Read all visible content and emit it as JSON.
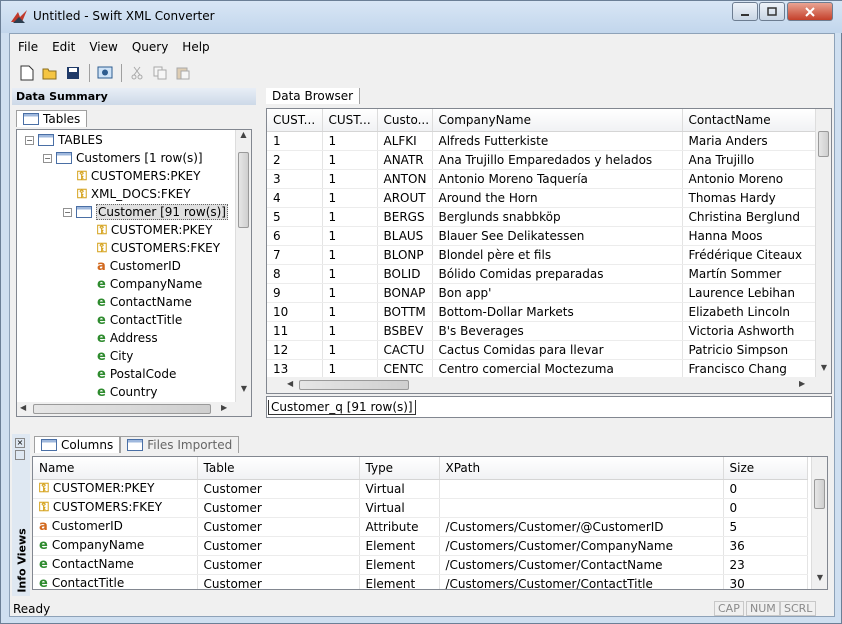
{
  "window": {
    "title": "Untitled - Swift XML Converter"
  },
  "menu": [
    "File",
    "Edit",
    "View",
    "Query",
    "Help"
  ],
  "data_summary": {
    "title": "Data Summary",
    "tab": "Tables",
    "tree": [
      {
        "label": "TABLES",
        "icon": "table-icon"
      },
      {
        "label": "Customers [1 row(s)]",
        "icon": "table-icon"
      },
      {
        "label": "CUSTOMERS:PKEY",
        "icon": "key-icon"
      },
      {
        "label": "XML_DOCS:FKEY",
        "icon": "key-icon"
      },
      {
        "label": "Customer [91 row(s)]",
        "icon": "table-icon"
      },
      {
        "label": "CUSTOMER:PKEY",
        "icon": "key-icon"
      },
      {
        "label": "CUSTOMERS:FKEY",
        "icon": "key-icon"
      },
      {
        "label": "CustomerID",
        "icon": "attribute-icon"
      },
      {
        "label": "CompanyName",
        "icon": "element-icon"
      },
      {
        "label": "ContactName",
        "icon": "element-icon"
      },
      {
        "label": "ContactTitle",
        "icon": "element-icon"
      },
      {
        "label": "Address",
        "icon": "element-icon"
      },
      {
        "label": "City",
        "icon": "element-icon"
      },
      {
        "label": "PostalCode",
        "icon": "element-icon"
      },
      {
        "label": "Country",
        "icon": "element-icon"
      }
    ]
  },
  "data_browser": {
    "tab": "Data Browser",
    "columns": [
      "CUST...",
      "CUST...",
      "Custo...",
      "CompanyName",
      "ContactName"
    ],
    "rows": [
      [
        "1",
        "1",
        "ALFKI",
        "Alfreds Futterkiste",
        "Maria Anders"
      ],
      [
        "2",
        "1",
        "ANATR",
        "Ana Trujillo Emparedados y helados",
        "Ana Trujillo"
      ],
      [
        "3",
        "1",
        "ANTON",
        "Antonio Moreno Taquería",
        "Antonio Moreno"
      ],
      [
        "4",
        "1",
        "AROUT",
        "Around the Horn",
        "Thomas Hardy"
      ],
      [
        "5",
        "1",
        "BERGS",
        "Berglunds snabbköp",
        "Christina Berglund"
      ],
      [
        "6",
        "1",
        "BLAUS",
        "Blauer See Delikatessen",
        "Hanna Moos"
      ],
      [
        "7",
        "1",
        "BLONP",
        "Blondel père et fils",
        "Frédérique Citeaux"
      ],
      [
        "8",
        "1",
        "BOLID",
        "Bólido Comidas preparadas",
        "Martín Sommer"
      ],
      [
        "9",
        "1",
        "BONAP",
        "Bon app'",
        "Laurence Lebihan"
      ],
      [
        "10",
        "1",
        "BOTTM",
        "Bottom-Dollar Markets",
        "Elizabeth Lincoln"
      ],
      [
        "11",
        "1",
        "BSBEV",
        "B's Beverages",
        "Victoria Ashworth"
      ],
      [
        "12",
        "1",
        "CACTU",
        "Cactus Comidas para llevar",
        "Patricio Simpson"
      ],
      [
        "13",
        "1",
        "CENTC",
        "Centro comercial Moctezuma",
        "Francisco Chang"
      ]
    ],
    "bottom_tab": "Customer_q [91 row(s)]"
  },
  "info_views": {
    "side_label": "Info Views",
    "tabs": [
      "Columns",
      "Files Imported"
    ],
    "columns": [
      "Name",
      "Table",
      "Type",
      "XPath",
      "Size"
    ],
    "rows": [
      {
        "icon": "key-icon",
        "name": "CUSTOMER:PKEY",
        "table": "Customer",
        "type": "Virtual",
        "xpath": "",
        "size": "0"
      },
      {
        "icon": "key-icon",
        "name": "CUSTOMERS:FKEY",
        "table": "Customer",
        "type": "Virtual",
        "xpath": "",
        "size": "0"
      },
      {
        "icon": "attribute-icon",
        "name": "CustomerID",
        "table": "Customer",
        "type": "Attribute",
        "xpath": "/Customers/Customer/@CustomerID",
        "size": "5"
      },
      {
        "icon": "element-icon",
        "name": "CompanyName",
        "table": "Customer",
        "type": "Element",
        "xpath": "/Customers/Customer/CompanyName",
        "size": "36"
      },
      {
        "icon": "element-icon",
        "name": "ContactName",
        "table": "Customer",
        "type": "Element",
        "xpath": "/Customers/Customer/ContactName",
        "size": "23"
      },
      {
        "icon": "element-icon",
        "name": "ContactTitle",
        "table": "Customer",
        "type": "Element",
        "xpath": "/Customers/Customer/ContactTitle",
        "size": "30"
      }
    ]
  },
  "status": {
    "text": "Ready",
    "indicators": [
      "CAP",
      "NUM",
      "SCRL"
    ]
  }
}
